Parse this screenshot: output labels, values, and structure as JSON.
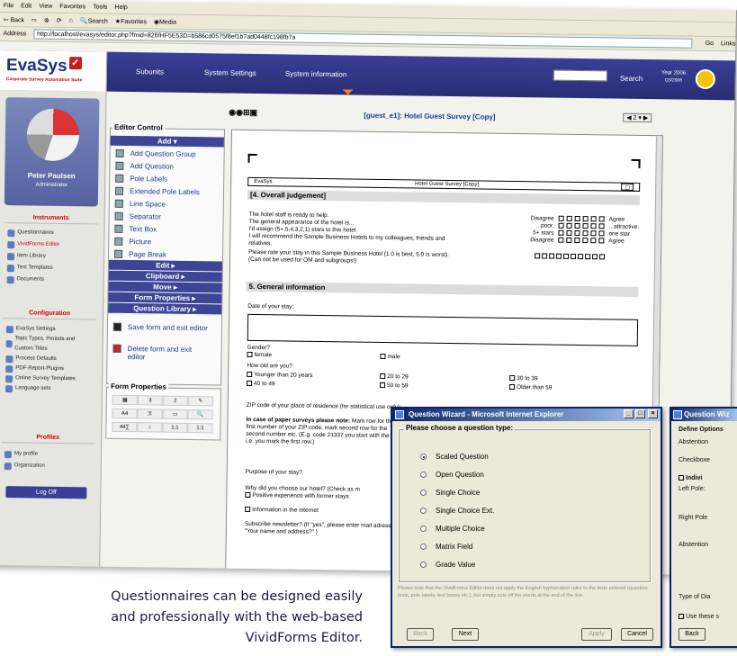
{
  "browser": {
    "menu": [
      "File",
      "Edit",
      "View",
      "Favorites",
      "Tools",
      "Help"
    ],
    "toolbar": [
      "Back",
      "Search",
      "Favorites",
      "Media"
    ],
    "address_label": "Address",
    "url": "http://localhost/evasys/editor.php?fmid=826fHF5E53D=b586cd0575f8ef1b7ad0448fc198fb7a",
    "go": "Go",
    "links": "Links"
  },
  "evasys": {
    "logo": "EvaSys",
    "logo_sub": "Corporate Survey Automation Suite",
    "nav": [
      "Subunits",
      "System Settings",
      "System information"
    ],
    "search_label": "Search",
    "year": "Year 2006",
    "year_sub": "Q3/2006"
  },
  "user": {
    "name": "Peter Paulsen",
    "role": "Administrator"
  },
  "sidebar": {
    "instruments_title": "Instruments",
    "instruments": [
      "Questionnaires",
      "VividForms Editor",
      "Item Library",
      "Text Templates",
      "Documents"
    ],
    "config_title": "Configuration",
    "config": [
      "EvaSys Settings",
      "Topic Types, Periods and Custom Titles",
      "Process Defaults",
      "PDF-Report-Plugins",
      "Online Survey Templates",
      "Language sets"
    ],
    "profiles_title": "Profiles",
    "profiles": [
      "My profile",
      "Organization"
    ],
    "logoff": "Log Off"
  },
  "editor_control": {
    "title": "Editor Control",
    "add_head": "Add ▾",
    "items": [
      "Add Question Group",
      "Add Question",
      "Pole Labels",
      "Extended Pole Labels",
      "Line Space",
      "Separator",
      "Text Box",
      "Picture",
      "Page Break"
    ],
    "heads": [
      "Edit ▸",
      "Clipboard ▸",
      "Move ▸",
      "Form Properties ▸",
      "Question Library ▸"
    ],
    "save": "Save form and exit editor",
    "delete": "Delete form and exit editor"
  },
  "form_properties": {
    "title": "Form Properties",
    "cells": [
      "3",
      "2",
      "A4",
      "44∑",
      "1:1",
      "1:1"
    ]
  },
  "doc": {
    "title": "[guest_e1]: Hotel Guest Survey [Copy]",
    "pager": "◀ 2 ▾ ▶",
    "header_left": "EvaSys",
    "header_mid": "Hotel Guest Survey [Copy]",
    "section4": "[4. Overall judgement]",
    "q4": [
      {
        "q": "The hotel staff is ready to help.",
        "l": "Disagree",
        "r": "Agree"
      },
      {
        "q": "The general appearance of the hotel is...",
        "l": "...poor.",
        "r": "...attractive."
      },
      {
        "q": "I'd assign (5+,5,4,3,2,1) stars to this hotel.",
        "l": "5+ stars",
        "r": "one star"
      },
      {
        "q": "I will recommend the Sample Business Hotels to my colleagues, friends and relatives.",
        "l": "Disagree",
        "r": "Agree"
      }
    ],
    "rate": "Please rate your stay in this Sample Business Hotel (1.0 is best, 5.0 is worst). (Can not be used for OM and subgroups!)",
    "section5": "5. General information",
    "date": "Date of your stay:",
    "gender": "Gender?",
    "female": "female",
    "male": "male",
    "age_q": "How old are you?",
    "ages": [
      "Younger than 20 years",
      "20 to 29",
      "30 to 39",
      "40 to 49",
      "50 to 59",
      "Older than 59"
    ],
    "zip": "ZIP code of your place of residence (for statistical use only):",
    "paper_bold": "In case of paper surveys please note:",
    "paper_rest": "Mark row for the first number of your ZIP code, mark second row for the second number etc. (E.g. code 21337 you start with the 2, i.e. you mark the first row.)",
    "purpose": "Purpose of your stay?",
    "why": "Why did you choose our hotel? (Check as m",
    "pos": "Positive experience with former stays",
    "internet": "Information in the internet",
    "subscribe": "Subscribe newsletter? (If \"yes\", please enter mail adress in \"Your name and address?\" )"
  },
  "wizard": {
    "title": "Question Wizard - Microsoft Internet Explorer",
    "legend": "Please choose a question type:",
    "options": [
      "Scaled Question",
      "Open Question",
      "Single Choice",
      "Single Choice Ext.",
      "Multiple Choice",
      "Matrix Field",
      "Grade Value"
    ],
    "selected": 0,
    "note": "Please note that the VividForms Editor does not apply the English hyphenation rules to the texts entered (question texts, pole labels, text boxes etc.), but simply cuts off the words at the end of the line.",
    "back": "Back",
    "next": "Next",
    "apply": "Apply",
    "cancel": "Cancel"
  },
  "wizard2": {
    "title": "Question Wiz",
    "legend": "Define Options",
    "abstention": "Abstention",
    "checkboxes": "Checkboxe",
    "indiv": "Indivi",
    "left_pole": "Left Pole:",
    "right_pole": "Right Pole",
    "abstention2": "Abstention",
    "type_dia": "Type of Dia",
    "use_these": "Use these s",
    "back": "Back"
  },
  "caption": "Questionnaires can be designed easily and professionally with the web-based VividForms Editor.",
  "colors": {
    "brand": "#2a2d75",
    "accent": "#f08020",
    "alert": "#c00000"
  }
}
